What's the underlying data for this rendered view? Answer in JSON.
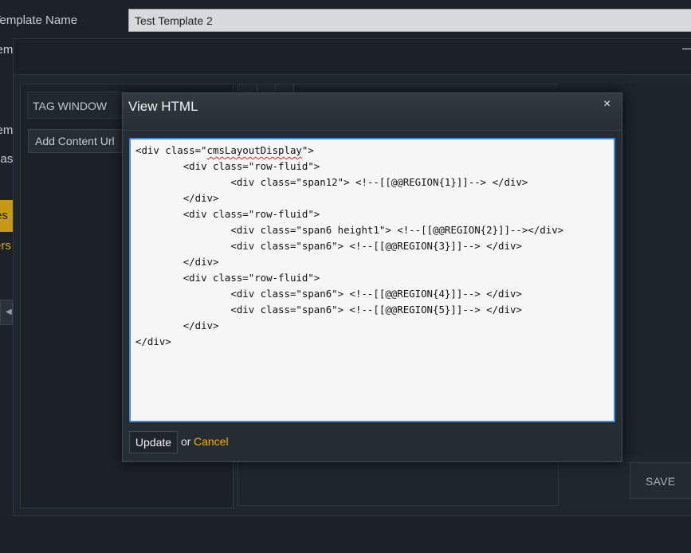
{
  "background": {
    "template_name_label": "Template Name",
    "template_name_value": "Test Template 2",
    "template_label_cut": "Temp",
    "side_label_1": "Temp",
    "side_label_2": "Maste",
    "gold_tab_text": "es",
    "gold_link_text": "ers",
    "tag_window_label": "TAG WINDOW",
    "add_content_url_label": "Add Content Url",
    "save_label": "SAVE",
    "minimize_glyph": "—",
    "left_arrow_glyph": "◀"
  },
  "modal": {
    "title": "View HTML",
    "close_glyph": "×",
    "code_lines": [
      "<div class=\"cmsLayoutDisplay\">",
      "\t<div class=\"row-fluid\">",
      "\t\t<div class=\"span12\"> <!--[[@@REGION{1}]]--> </div>",
      "\t</div>",
      "\t<div class=\"row-fluid\">",
      "\t\t<div class=\"span6 height1\"> <!--[[@@REGION{2}]]--></div>",
      "\t\t<div class=\"span6\"> <!--[[@@REGION{3}]]--> </div>",
      "\t</div>",
      "\t<div class=\"row-fluid\">",
      "\t\t<div class=\"span6\"> <!--[[@@REGION{4}]]--> </div>",
      "\t\t<div class=\"span6\"> <!--[[@@REGION{5}]]--> </div>",
      "\t</div>",
      "</div>"
    ],
    "update_label": "Update",
    "or_text": "or",
    "cancel_label": "Cancel",
    "colors": {
      "accent_border": "#3c8ed6",
      "cancel_link": "#f2ad18",
      "spellcheck": "#e0201e"
    }
  }
}
